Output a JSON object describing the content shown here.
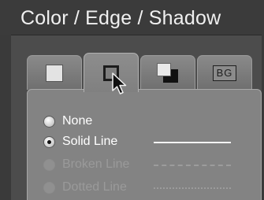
{
  "header": {
    "title": "Color / Edge / Shadow"
  },
  "tabs": [
    {
      "name": "fill-color",
      "icon": "color-fill-icon",
      "active": false
    },
    {
      "name": "edge",
      "icon": "edge-outline-icon",
      "active": true
    },
    {
      "name": "shadow",
      "icon": "shadow-icon",
      "active": false
    },
    {
      "name": "background",
      "icon": "bg-icon",
      "active": false,
      "label": "BG"
    }
  ],
  "edge_options": [
    {
      "label": "None",
      "checked": false,
      "disabled": false,
      "sample": "none"
    },
    {
      "label": "Solid Line",
      "checked": true,
      "disabled": false,
      "sample": "solid"
    },
    {
      "label": "Broken Line",
      "checked": false,
      "disabled": true,
      "sample": "dashed"
    },
    {
      "label": "Dotted Line",
      "checked": false,
      "disabled": true,
      "sample": "dotted"
    }
  ],
  "colors": {
    "header_bg": "#3b3b3b",
    "panel_bg": "#4c4c4c",
    "content_bg": "#838383",
    "disabled_text": "#9a9a9a"
  }
}
